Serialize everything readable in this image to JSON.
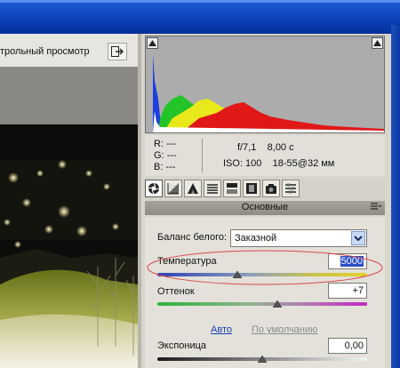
{
  "preview": {
    "label": "трольный просмотр",
    "toggle_icon": "swap-arrow-icon"
  },
  "camera_info": {
    "r_label": "R:",
    "g_label": "G:",
    "b_label": "B:",
    "r_value": "---",
    "g_value": "---",
    "b_value": "---",
    "aperture": "f/7,1",
    "shutter": "8,00 с",
    "iso": "ISO: 100",
    "lens": "18-55@32 мм"
  },
  "tabs": [
    {
      "icon": "aperture-icon",
      "active": true
    },
    {
      "icon": "tone-curve-icon"
    },
    {
      "icon": "detail-triangle-icon"
    },
    {
      "icon": "hsl-bars-icon"
    },
    {
      "icon": "split-toning-icon"
    },
    {
      "icon": "lens-corrections-icon"
    },
    {
      "icon": "camera-calibration-icon"
    },
    {
      "icon": "presets-icon"
    }
  ],
  "section": {
    "title": "Основные",
    "menu_icon": "panel-menu-icon"
  },
  "white_balance": {
    "label": "Баланс белого:",
    "value": "Заказной"
  },
  "temperature": {
    "label": "Температура",
    "value": "5000",
    "slider_fraction": 0.38
  },
  "tint": {
    "label": "Оттенок",
    "value": "+7",
    "slider_fraction": 0.57
  },
  "auto_link": "Авто",
  "default_link": "По умолчанию",
  "exposure": {
    "label": "Экспоница",
    "value": "0,00",
    "slider_fraction": 0.5
  },
  "colors": {
    "highlight_ellipse": "#d84a4a",
    "selection": "#2b4fc6",
    "link_active": "#1a3fb0",
    "link_disabled": "#8a8a8a"
  }
}
